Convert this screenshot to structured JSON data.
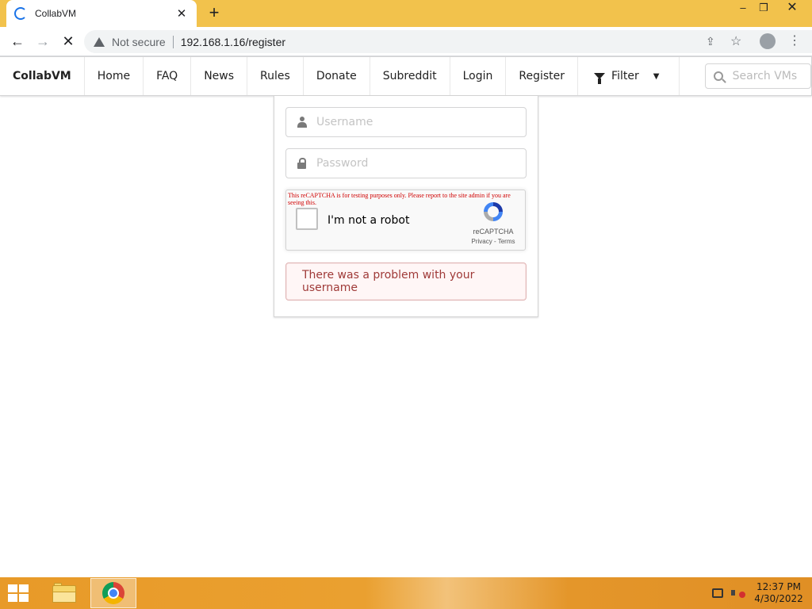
{
  "browser": {
    "tab_title": "CollabVM",
    "tab_close": "✕",
    "new_tab": "+",
    "window_min": "–",
    "window_restore": "❐",
    "window_close": "✕",
    "nav_back": "←",
    "nav_forward": "→",
    "nav_stop": "✕",
    "security_label": "Not secure",
    "url": "192.168.1.16/register",
    "share_glyph": "⇪",
    "bookmark_glyph": "☆",
    "menu_glyph": "⋮"
  },
  "site_nav": {
    "brand": "CollabVM",
    "items": [
      {
        "label": "Home"
      },
      {
        "label": "FAQ"
      },
      {
        "label": "News"
      },
      {
        "label": "Rules"
      },
      {
        "label": "Donate"
      },
      {
        "label": "Subreddit"
      },
      {
        "label": "Login"
      },
      {
        "label": "Register"
      }
    ],
    "filter_label": "Filter",
    "filter_caret": "▼",
    "search_placeholder": "Search VMs"
  },
  "form": {
    "username_placeholder": "Username",
    "password_placeholder": "Password",
    "captcha": {
      "warning": "This reCAPTCHA is for testing purposes only. Please report to the site admin if you are seeing this.",
      "label": "I'm not a robot",
      "brand": "reCAPTCHA",
      "terms": "Privacy - Terms"
    },
    "error_message": "There was a problem with your username"
  },
  "taskbar": {
    "time": "12:37 PM",
    "date": "4/30/2022"
  },
  "colors": {
    "titlebar": "#f2c24c",
    "error_bg": "#fff6f6",
    "error_text": "#9f3a38",
    "captcha_warning": "#d00000",
    "taskbar": "#e89a28"
  },
  "icons": [
    "loading-spinner-icon",
    "warning-icon",
    "share-icon",
    "star-icon",
    "profile-icon",
    "menu-icon",
    "filter-icon",
    "search-icon",
    "user-icon",
    "lock-icon",
    "recaptcha-logo-icon",
    "windows-logo-icon",
    "file-explorer-icon",
    "chrome-icon",
    "network-icon",
    "volume-muted-icon"
  ]
}
